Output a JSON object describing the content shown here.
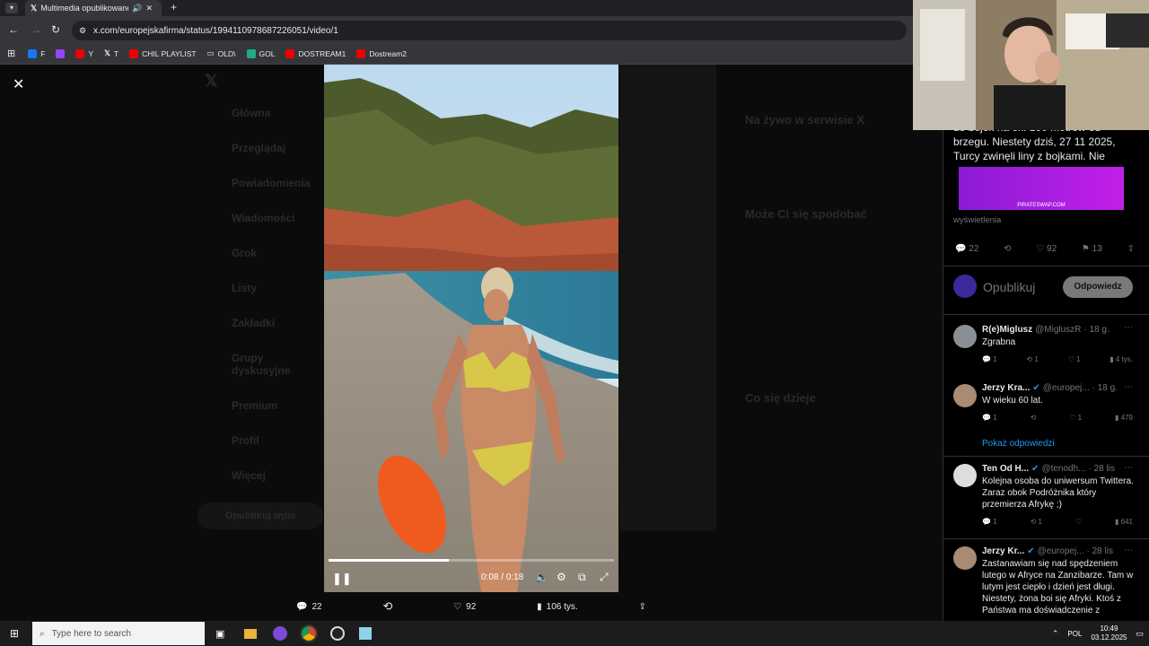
{
  "browser": {
    "tab_title": "Multimedia opublikowane p",
    "url": "x.com/europejskafirma/status/1994110978687226051/video/1",
    "bookmarks": [
      "F",
      "Y",
      "T",
      "CHIL PLAYLIST",
      "OLD\\",
      "GOL",
      "DOSTREAM1",
      "Dostream2"
    ]
  },
  "sidebar": {
    "items": [
      "Główna",
      "Przeglądaj",
      "Powiadomienia",
      "Wiadomości",
      "Grok",
      "Listy",
      "Zakładki",
      "Grupy dyskusyjne",
      "Premium",
      "Profil",
      "Więcej"
    ],
    "post_button": "Opublikuj wpis"
  },
  "video": {
    "time": "0:08 / 0:18",
    "progress_fraction": 0.42
  },
  "video_actions": {
    "replies": "22",
    "likes": "92",
    "views": "106 tys."
  },
  "tweet": {
    "lines": [
      "do bojek na ok. 100 metrów od",
      "brzegu. Niestety dziś, 27 11 2025,",
      "Turcy zwinęli liny z bojkami.  Nie"
    ],
    "views_label": "wyświetlenia",
    "ad_text": "PIRATESWAP.COM",
    "stats": {
      "replies": "22",
      "likes": "92",
      "bookmarks": "13"
    }
  },
  "compose": {
    "placeholder": "Opublikuj",
    "reply_button": "Odpowiedz"
  },
  "replies": [
    {
      "name": "R(e)Miglusz",
      "handle": "@MigluszR",
      "time": "· 18 g.",
      "text": "Zgrabna",
      "stats": [
        "1",
        "1",
        "1",
        "4 tys."
      ]
    },
    {
      "name": "Jerzy Kra...",
      "handle": "@europej...",
      "time": "· 18 g.",
      "text": "W wieku 60 lat.",
      "stats": [
        "1",
        "",
        "1",
        "479"
      ]
    },
    {
      "name": "Ten Od H...",
      "handle": "@tenodh...",
      "time": "· 28 lis",
      "text": "Kolejna osoba do uniwersum Twittera. Zaraz obok Podróżnika który przemierza Afrykę ;)",
      "stats": [
        "1",
        "1",
        "",
        "641"
      ]
    },
    {
      "name": "Jerzy Kr...",
      "handle": "@europej...",
      "time": "· 28 lis",
      "text": "Zastanawiam się nad spędzeniem lutego w Afryce na Zanzibarze. Tam w lutym jest ciepło i dzień jest długi. Niestety, żona boi się Afryki. Ktoś z Państwa ma doświadczenie z",
      "stats": []
    }
  ],
  "show_replies": "Pokaż odpowiedzi",
  "right_panel": {
    "live_title": "Na żywo w serwisie X",
    "suggest_title": "Może Ci się spodobać",
    "trends_title": "Co się dzieje"
  },
  "taskbar": {
    "search_placeholder": "Type here to search",
    "lang": "POL",
    "time": "10:49",
    "date": "03.12.2025"
  }
}
